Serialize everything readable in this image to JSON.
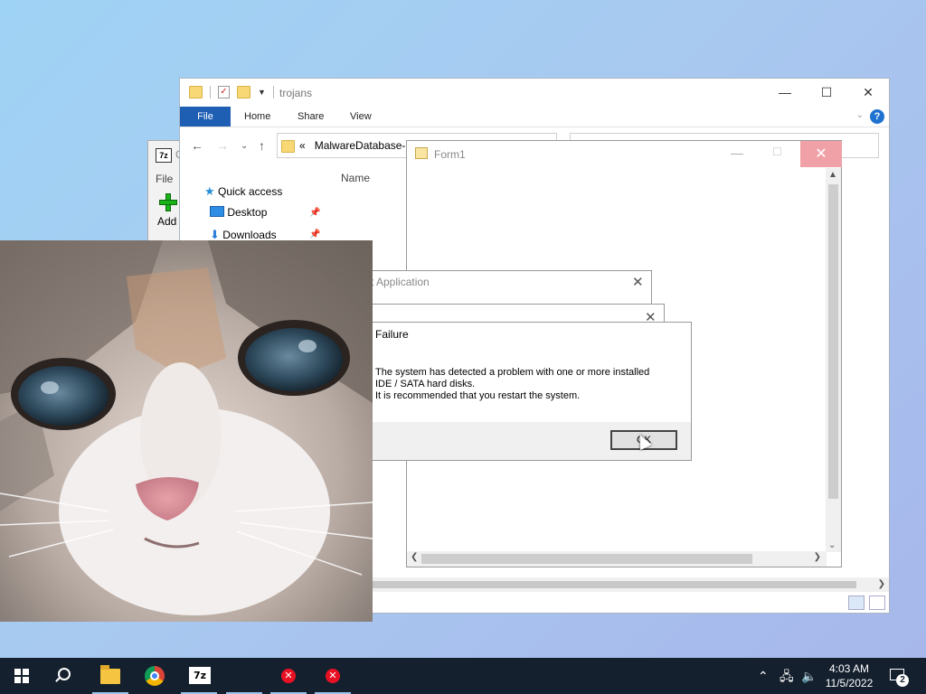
{
  "explorer": {
    "title": "trojans",
    "ribbon_tabs": [
      "File",
      "Home",
      "Share",
      "View"
    ],
    "address_prefix": "«",
    "address_crumb": "MalwareDatabase-...",
    "column_header": "Name",
    "nav_items": [
      "Quick access",
      "Desktop",
      "Downloads"
    ],
    "help_label": "?"
  },
  "sevenzip": {
    "title_partial": "C",
    "menu_file": "File",
    "add_label": "Add",
    "icon_text": "7z"
  },
  "form1": {
    "title": "Form1"
  },
  "dialogs": {
    "app_title_partial": "t Application",
    "error_title": "Failure",
    "message": "The system has detected a problem with one or more installed\nIDE / SATA hard disks.\nIt is recommended that you restart the system.",
    "ok_label": "OK"
  },
  "taskbar": {
    "time": "4:03 AM",
    "date": "11/5/2022",
    "notification_count": "2",
    "sevenzip_icon_text": "7z",
    "apps": [
      "start-icon",
      "search-icon",
      "file-explorer-icon",
      "chrome-icon",
      "7zip-icon",
      "error-app-icon",
      "error-app-icon"
    ]
  },
  "colors": {
    "desktop_start": "#9fd3f5",
    "desktop_end": "#a7b6ea",
    "ribbon_file": "#1e5fb4",
    "taskbar": "#15202e",
    "close_hover": "#f0a1a8",
    "error_red": "#e81123"
  }
}
